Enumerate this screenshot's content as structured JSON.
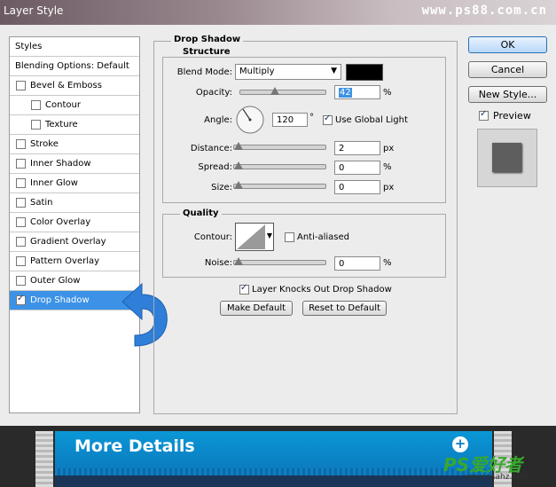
{
  "window": {
    "title": "Layer Style",
    "watermark": "www.ps88.com.cn"
  },
  "styles_panel": {
    "header": "Styles",
    "blending": "Blending Options: Default",
    "items": [
      {
        "label": "Bevel & Emboss",
        "checked": false,
        "indent": false
      },
      {
        "label": "Contour",
        "checked": false,
        "indent": true
      },
      {
        "label": "Texture",
        "checked": false,
        "indent": true
      },
      {
        "label": "Stroke",
        "checked": false,
        "indent": false
      },
      {
        "label": "Inner Shadow",
        "checked": false,
        "indent": false
      },
      {
        "label": "Inner Glow",
        "checked": false,
        "indent": false
      },
      {
        "label": "Satin",
        "checked": false,
        "indent": false
      },
      {
        "label": "Color Overlay",
        "checked": false,
        "indent": false
      },
      {
        "label": "Gradient Overlay",
        "checked": false,
        "indent": false
      },
      {
        "label": "Pattern Overlay",
        "checked": false,
        "indent": false
      },
      {
        "label": "Outer Glow",
        "checked": false,
        "indent": false
      },
      {
        "label": "Drop Shadow",
        "checked": true,
        "indent": false,
        "selected": true
      }
    ]
  },
  "drop_shadow": {
    "title": "Drop Shadow",
    "structure": {
      "title": "Structure",
      "blend_mode_label": "Blend Mode:",
      "blend_mode_value": "Multiply",
      "shadow_color": "#000000",
      "opacity_label": "Opacity:",
      "opacity_value": "42",
      "opacity_level": 0.42,
      "opacity_unit": "%",
      "angle_label": "Angle:",
      "angle_value": "120",
      "angle_unit": "°",
      "global_light_label": "Use Global Light",
      "global_light_checked": true,
      "distance_label": "Distance:",
      "distance_value": "2",
      "distance_unit": "px",
      "spread_label": "Spread:",
      "spread_value": "0",
      "spread_unit": "%",
      "size_label": "Size:",
      "size_value": "0",
      "size_unit": "px"
    },
    "quality": {
      "title": "Quality",
      "contour_label": "Contour:",
      "anti_aliased_label": "Anti-aliased",
      "anti_aliased_checked": false,
      "noise_label": "Noise:",
      "noise_value": "0",
      "noise_unit": "%"
    },
    "knockout_label": "Layer Knocks Out Drop Shadow",
    "knockout_checked": true,
    "make_default": "Make Default",
    "reset_default": "Reset to Default"
  },
  "buttons": {
    "ok": "OK",
    "cancel": "Cancel",
    "new_style": "New Style...",
    "preview_label": "Preview",
    "preview_checked": true
  },
  "banner": {
    "title": "More Details"
  },
  "logo": {
    "text": "PS爱好者",
    "url_text": "www.psahz.com"
  },
  "colors": {
    "selection": "#3c92e6",
    "banner": "#0a8fd0",
    "arrow": "#2f7fd8"
  }
}
